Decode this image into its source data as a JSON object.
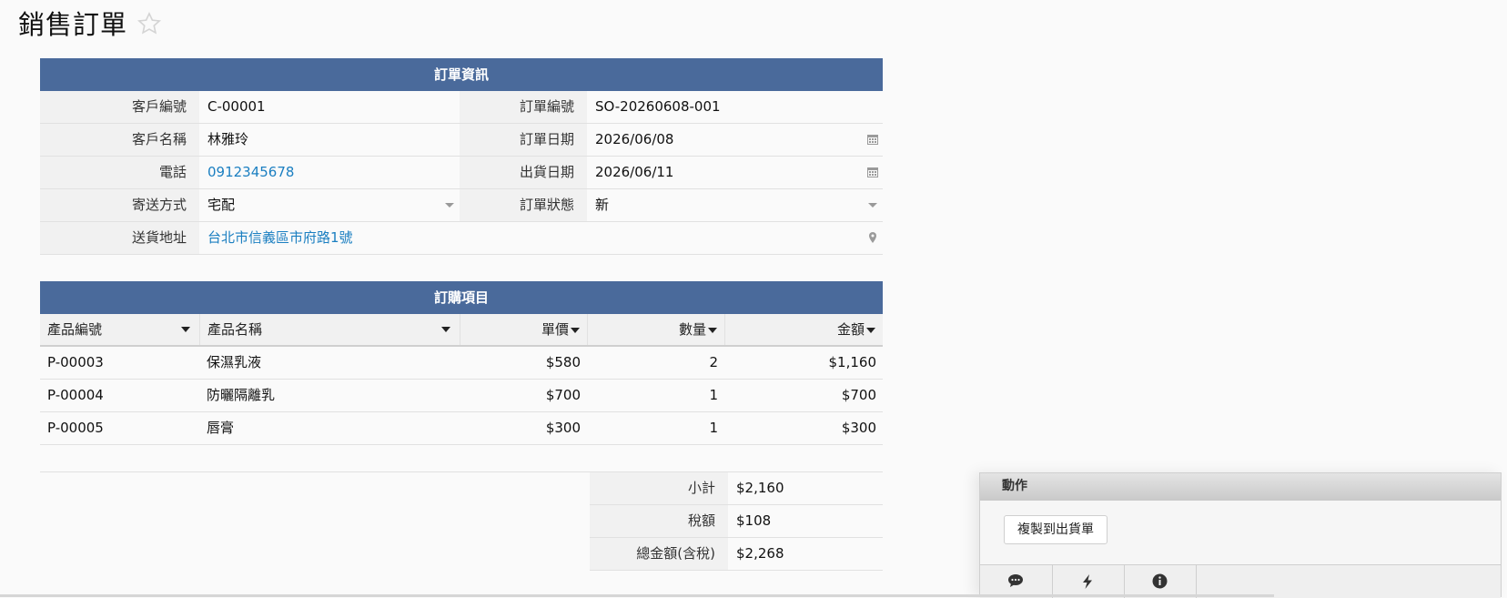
{
  "page": {
    "title": "銷售訂單"
  },
  "order_info": {
    "header": "訂單資訊",
    "customer_id_label": "客戶編號",
    "customer_id": "C-00001",
    "order_no_label": "訂單編號",
    "order_no": "SO-20260608-001",
    "customer_name_label": "客戶名稱",
    "customer_name": "林雅玲",
    "order_date_label": "訂單日期",
    "order_date": "2026/06/08",
    "phone_label": "電話",
    "phone": "0912345678",
    "ship_date_label": "出貨日期",
    "ship_date": "2026/06/11",
    "delivery_label": "寄送方式",
    "delivery": "宅配",
    "status_label": "訂單狀態",
    "status": "新",
    "address_label": "送貨地址",
    "address": "台北市信義區市府路1號"
  },
  "items": {
    "header": "訂購項目",
    "columns": [
      "產品編號",
      "產品名稱",
      "單價",
      "數量",
      "金額"
    ],
    "rows": [
      [
        "P-00003",
        "保濕乳液",
        "$580",
        "2",
        "$1,160"
      ],
      [
        "P-00004",
        "防曬隔離乳",
        "$700",
        "1",
        "$700"
      ],
      [
        "P-00005",
        "唇膏",
        "$300",
        "1",
        "$300"
      ]
    ]
  },
  "totals": {
    "subtotal_label": "小計",
    "subtotal": "$2,160",
    "tax_label": "稅額",
    "tax": "$108",
    "total_label": "總金額(含稅)",
    "total": "$2,268"
  },
  "actions": {
    "header": "動作",
    "copy_button": "複製到出貨單",
    "tab_icons": [
      "comment-icon",
      "bolt-icon",
      "info-icon"
    ]
  },
  "colors": {
    "header_bg": "#4a6a9b",
    "link": "#1b7fc1"
  }
}
